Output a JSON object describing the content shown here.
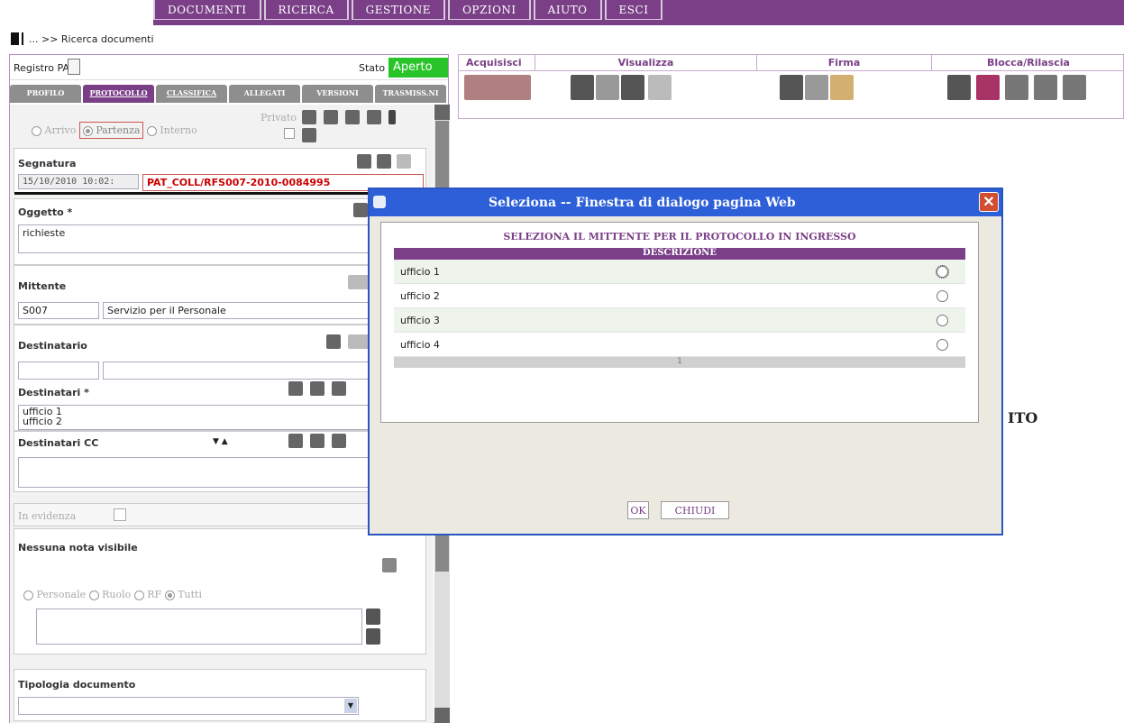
{
  "menu": [
    "DOCUMENTI",
    "RICERCA",
    "GESTIONE",
    "OPZIONI",
    "AIUTO",
    "ESCI"
  ],
  "breadcrumb": "... >> Ricerca documenti",
  "registry": {
    "label": "Registro PAT",
    "stato_label": "Stato",
    "stato_value": "Aperto"
  },
  "tabs": [
    "PROFILO",
    "PROTOCOLLO",
    "CLASSIFICA",
    "ALLEGATI",
    "VERSIONI",
    "TRASMISS.NI"
  ],
  "form": {
    "direction": [
      "Arrivo",
      "Partenza",
      "Interno"
    ],
    "private_label": "Privato",
    "segnatura_label": "Segnatura",
    "segnatura_date": "15/10/2010 10:02:",
    "segnatura_code": "PAT_COLL/RFS007-2010-0084995",
    "oggetto_label": "Oggetto *",
    "oggetto_value": "richieste",
    "mittente_label": "Mittente",
    "mittente_code": "S007",
    "mittente_desc": "Servizio per il Personale",
    "destinatario_label": "Destinatario",
    "destinatari_label": "Destinatari *",
    "destinatari_list": [
      "ufficio 1",
      "ufficio 2"
    ],
    "destinatari_cc_label": "Destinatari CC",
    "in_evidenza_label": "In evidenza",
    "note_label": "Nessuna nota visibile",
    "note_scope": [
      "Personale",
      "Ruolo",
      "RF",
      "Tutti"
    ],
    "tipologia_label": "Tipologia documento"
  },
  "toolbar": {
    "groups": [
      "Acquisisci",
      "Visualizza",
      "Firma",
      "Blocca/Rilascia"
    ]
  },
  "dialog": {
    "title": "Seleziona -- Finestra di dialogo pagina Web",
    "heading": "SELEZIONA IL MITTENTE PER IL PROTOCOLLO IN INGRESSO",
    "column": "DESCRIZIONE",
    "rows": [
      "ufficio 1",
      "ufficio 2",
      "ufficio 3",
      "ufficio 4"
    ],
    "page": "1",
    "ok": "OK",
    "close": "CHIUDI"
  },
  "background_text": "ITO"
}
